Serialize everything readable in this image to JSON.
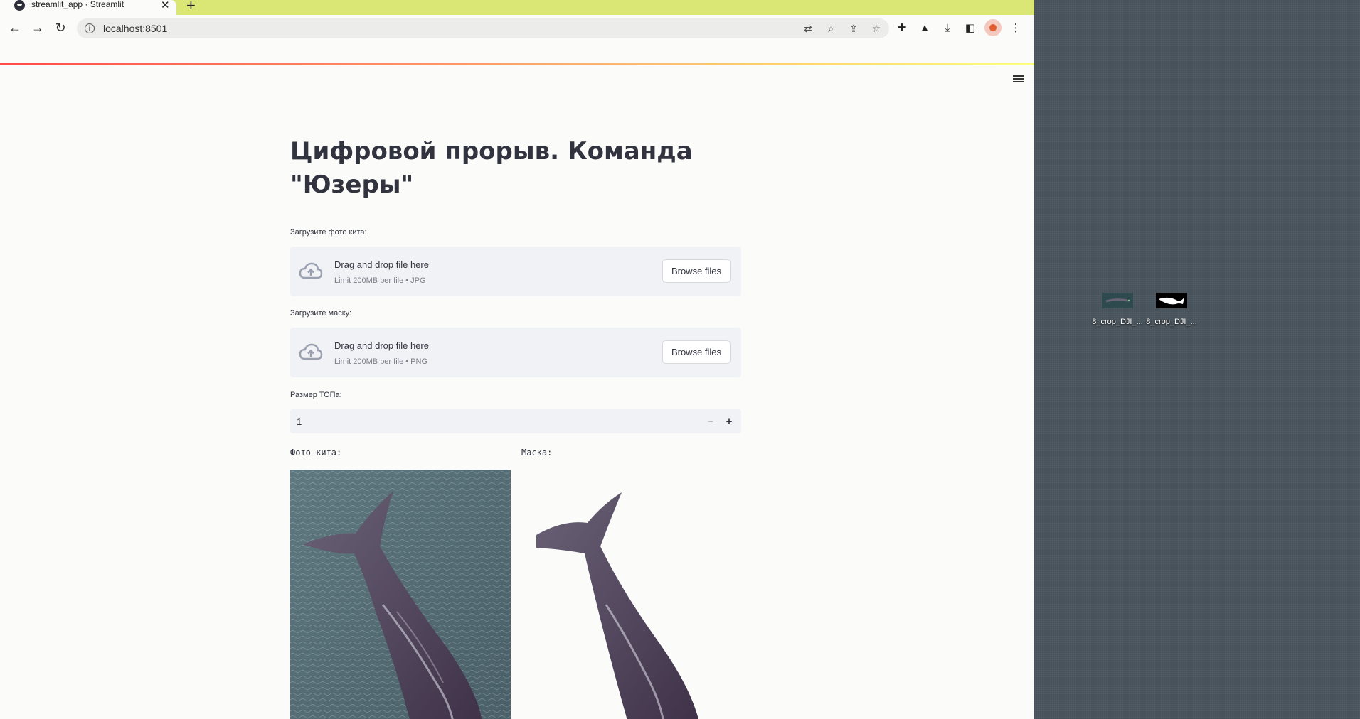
{
  "browser": {
    "tab_title": "streamlit_app · Streamlit",
    "url": "localhost:8501"
  },
  "page": {
    "title_line1": "Цифровой прорыв. Команда",
    "title_line2": "\"Юзеры\"",
    "photo_uploader": {
      "label": "Загрузите фото кита:",
      "drag_text": "Drag and drop file here",
      "limit_text": "Limit 200MB per file • JPG",
      "button": "Browse files"
    },
    "mask_uploader": {
      "label": "Загрузите маску:",
      "drag_text": "Drag and drop file here",
      "limit_text": "Limit 200MB per file • PNG",
      "button": "Browse files"
    },
    "top_size": {
      "label": "Размер ТОПа:",
      "value": "1",
      "minus": "−",
      "plus": "+"
    },
    "photo_caption": "Фото кита:",
    "mask_caption": "Маска:"
  },
  "desktop": {
    "icons": [
      {
        "label": "8_crop_DJI_..."
      },
      {
        "label": "8_crop_DJI_..."
      }
    ]
  }
}
